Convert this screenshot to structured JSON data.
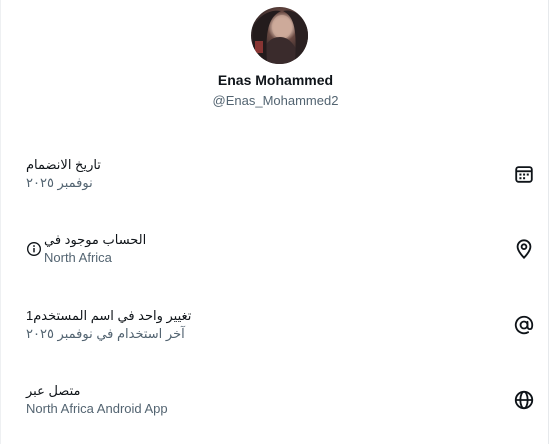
{
  "profile": {
    "name": "Enas Mohammed",
    "handle": "@Enas_Mohammed2"
  },
  "rows": [
    {
      "title": "تاريخ الانضمام",
      "subtitle": "نوفمبر ٢٠٢٥",
      "icon": "calendar-icon"
    },
    {
      "title": "الحساب موجود في",
      "subtitle": "North Africa",
      "icon": "location-pin-icon",
      "extra_icon": "info-icon"
    },
    {
      "title": "تغيير واحد في اسم المستخدم1",
      "subtitle": "آخر استخدام في نوفمبر ٢٠٢٥",
      "icon": "at-sign-icon"
    },
    {
      "title": "متصل عبر",
      "subtitle": "North Africa Android App",
      "icon": "globe-icon"
    }
  ]
}
